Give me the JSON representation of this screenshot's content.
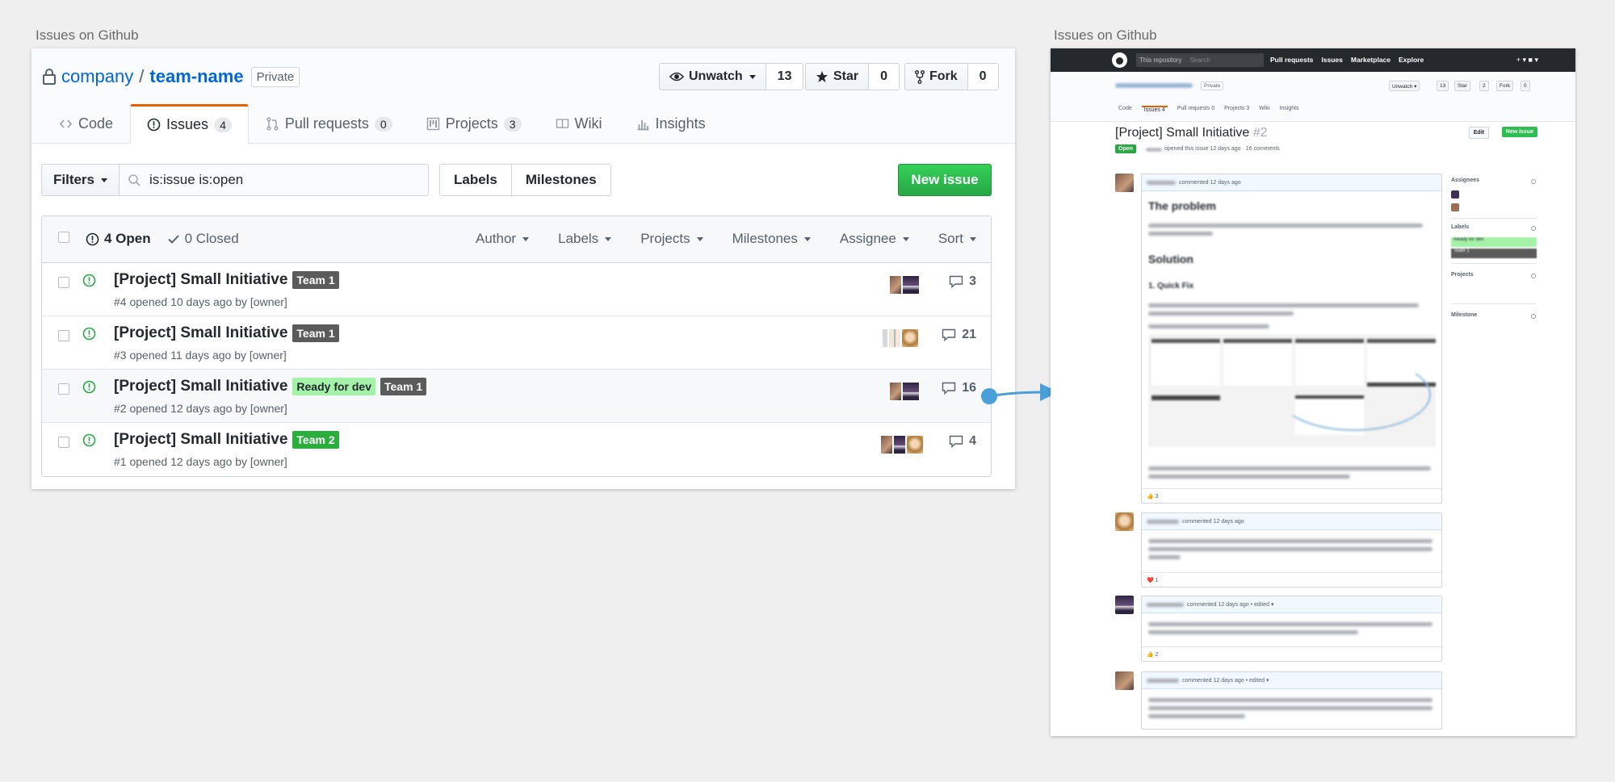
{
  "captions": {
    "left": "Issues on Github",
    "right": "Issues on Github"
  },
  "repo": {
    "owner": "company",
    "separator": "/",
    "name": "team-name",
    "visibility": "Private"
  },
  "actions": {
    "unwatch_label": "Unwatch",
    "unwatch_count": "13",
    "star_label": "Star",
    "star_count": "0",
    "fork_label": "Fork",
    "fork_count": "0"
  },
  "tabs": {
    "code": "Code",
    "issues": "Issues",
    "issues_count": "4",
    "pulls": "Pull requests",
    "pulls_count": "0",
    "projects": "Projects",
    "projects_count": "3",
    "wiki": "Wiki",
    "insights": "Insights"
  },
  "subnav": {
    "filters_label": "Filters",
    "search_value": "is:issue is:open",
    "labels_label": "Labels",
    "milestones_label": "Milestones",
    "new_issue_label": "New issue"
  },
  "list_header": {
    "open_label": "4 Open",
    "closed_label": "0 Closed",
    "filters": [
      "Author",
      "Labels",
      "Projects",
      "Milestones",
      "Assignee",
      "Sort"
    ]
  },
  "issues": [
    {
      "title": "[Project] Small Initiative",
      "labels": [
        {
          "name": "Team 1",
          "color": "#5b5b5b"
        }
      ],
      "meta": "#4 opened 10 days ago by [owner]",
      "comments": "3"
    },
    {
      "title": "[Project] Small Initiative",
      "labels": [
        {
          "name": "Team 1",
          "color": "#5b5b5b"
        }
      ],
      "meta": "#3 opened 11 days ago by [owner]",
      "comments": "21"
    },
    {
      "title": "[Project] Small Initiative",
      "labels": [
        {
          "name": "Ready for dev",
          "color": "#a4f1a8"
        },
        {
          "name": "Team 1",
          "color": "#5b5b5b"
        }
      ],
      "meta": "#2 opened 12 days ago by [owner]",
      "comments": "16"
    },
    {
      "title": "[Project] Small Initiative",
      "labels": [
        {
          "name": "Team 2",
          "color": "#2cae3f"
        }
      ],
      "meta": "#1 opened 12 days ago by [owner]",
      "comments": "4"
    }
  ],
  "detail": {
    "header": {
      "search_scope": "This repository",
      "search_placeholder": "Search",
      "nav": [
        "Pull requests",
        "Issues",
        "Marketplace",
        "Explore"
      ],
      "right_icons": "+ ▾   ■ ▾"
    },
    "repo_private": "Private",
    "buttons": {
      "unwatch": "Unwatch ▾",
      "unwatch_count": "13",
      "star": "Star",
      "star_count": "2",
      "fork": "Fork",
      "fork_count": "0"
    },
    "tabs": [
      "Code",
      "Issues 4",
      "Pull requests 0",
      "Projects 3",
      "Wiki",
      "Insights"
    ],
    "title": "[Project] Small Initiative",
    "number": "#2",
    "state": "Open",
    "meta": "opened this issue 12 days ago · 16 comments",
    "edit_label": "Edit",
    "new_issue_label": "New issue",
    "first_comment": {
      "head": "commented 12 days ago",
      "heading1": "The problem",
      "heading2": "Solution",
      "heading3": "1. Quick Fix",
      "reaction": "👍 3"
    },
    "comments": [
      {
        "head": "commented 12 days ago",
        "reaction": "❤️ 1"
      },
      {
        "head": "commented 12 days ago • edited ▾",
        "reaction": "👍 2"
      },
      {
        "head": "commented 12 days ago • edited ▾",
        "reaction": ""
      }
    ],
    "sidebar": {
      "assignees": "Assignees",
      "labels": "Labels",
      "projects": "Projects",
      "milestone": "Milestone",
      "label_chips": [
        {
          "name": "Ready for dev",
          "color": "#a4f1a8"
        },
        {
          "name": "Team 1",
          "color": "#5b5b5b"
        }
      ]
    }
  },
  "colors": {
    "accent_link": "#0366d6",
    "open_green": "#28a745",
    "tab_orange": "#e36209",
    "arrow_blue": "#4a9fd8"
  }
}
